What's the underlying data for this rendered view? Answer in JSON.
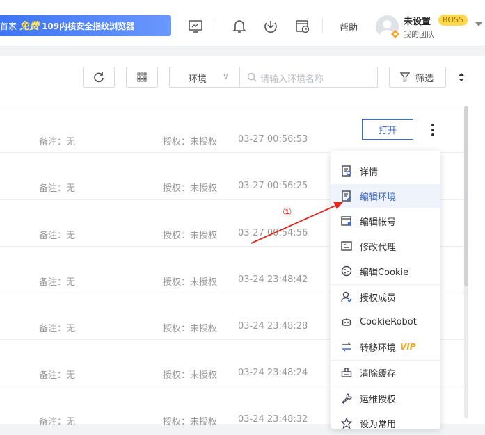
{
  "header": {
    "banner_prefix": "首家",
    "banner_free": "免费",
    "banner_text": "109内核安全指纹浏览器",
    "help": "帮助",
    "user_name": "未设置",
    "badge": "BOSS",
    "team": "我的团队"
  },
  "toolbar": {
    "env_select": "环境",
    "search_placeholder": "请输入环境名称",
    "filter": "筛选"
  },
  "rows": [
    {
      "note": "备注：无",
      "auth": "授权：未授权",
      "time": "03-27 00:56:53"
    },
    {
      "note": "备注：无",
      "auth": "授权：未授权",
      "time": "03-27 00:56:25"
    },
    {
      "note": "备注：无",
      "auth": "授权：未授权",
      "time": "03-27 00:54:56"
    },
    {
      "note": "备注：无",
      "auth": "授权：未授权",
      "time": "03-24 23:48:42"
    },
    {
      "note": "备注：无",
      "auth": "授权：未授权",
      "time": "03-24 23:48:28"
    },
    {
      "note": "备注：无",
      "auth": "授权：未授权",
      "time": "03-24 23:48:24"
    },
    {
      "note": "备注：无",
      "auth": "授权：未授权",
      "time": "03-24 23:48:32"
    }
  ],
  "open_button": "打开",
  "menu": {
    "items": [
      {
        "label": "详情",
        "icon": "details-icon"
      },
      {
        "label": "编辑环境",
        "icon": "edit-env-icon"
      },
      {
        "label": "编辑帐号",
        "icon": "edit-account-icon"
      },
      {
        "label": "修改代理",
        "icon": "proxy-icon"
      },
      {
        "label": "编辑Cookie",
        "icon": "cookie-icon"
      },
      {
        "label": "授权成员",
        "icon": "user-auth-icon"
      },
      {
        "label": "CookieRobot",
        "icon": "robot-icon"
      },
      {
        "label": "转移环境",
        "icon": "transfer-icon",
        "vip": "VIP"
      },
      {
        "label": "清除缓存",
        "icon": "clear-cache-icon"
      },
      {
        "label": "运维授权",
        "icon": "wrench-icon"
      },
      {
        "label": "设为常用",
        "icon": "star-icon"
      }
    ]
  },
  "annotation": "①",
  "colors": {
    "accent": "#3a6bd8",
    "annotation": "#e0261c",
    "badge": "#ffd84d"
  }
}
